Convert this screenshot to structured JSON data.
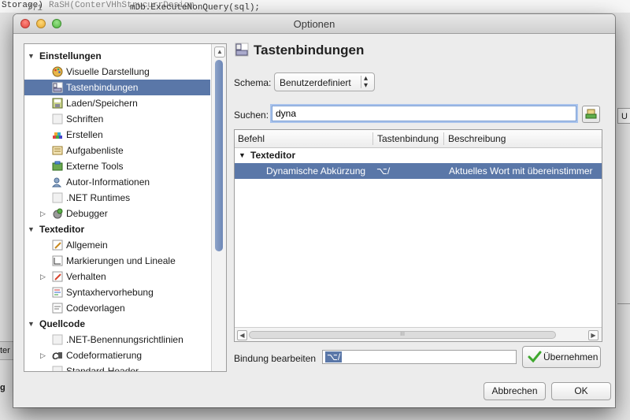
{
  "background": {
    "code_line_1": "Storage)",
    "code_line_2": "RaSH(ConterVHhStrucurrDesign",
    "line_number": "771",
    "code_line_3": "mDb.ExecuteNonQuery(sql);",
    "left_strip_text": "ter",
    "left_bold_text": "g",
    "right_button_text": "U"
  },
  "window": {
    "title": "Optionen"
  },
  "tree": {
    "groups": [
      {
        "label": "Einstellungen",
        "items": [
          {
            "label": "Visuelle Darstellung",
            "icon": "palette-icon"
          },
          {
            "label": "Tastenbindungen",
            "icon": "keybinding-icon",
            "selected": true
          },
          {
            "label": "Laden/Speichern",
            "icon": "save-icon"
          },
          {
            "label": "Schriften",
            "icon": "fonts-icon"
          },
          {
            "label": "Erstellen",
            "icon": "build-icon"
          },
          {
            "label": "Aufgabenliste",
            "icon": "tasklist-icon"
          },
          {
            "label": "Externe Tools",
            "icon": "tools-icon"
          },
          {
            "label": "Autor-Informationen",
            "icon": "author-icon"
          },
          {
            "label": ".NET Runtimes",
            "icon": "runtime-icon"
          },
          {
            "label": "Debugger",
            "icon": "debugger-icon",
            "collapsible": true
          }
        ]
      },
      {
        "label": "Texteditor",
        "items": [
          {
            "label": "Allgemein",
            "icon": "edit-icon"
          },
          {
            "label": "Markierungen und Lineale",
            "icon": "ruler-icon"
          },
          {
            "label": "Verhalten",
            "icon": "behavior-icon",
            "collapsible": true
          },
          {
            "label": "Syntaxhervorhebung",
            "icon": "syntax-icon"
          },
          {
            "label": "Codevorlagen",
            "icon": "template-icon"
          }
        ]
      },
      {
        "label": "Quellcode",
        "items": [
          {
            "label": ".NET-Benennungsrichtlinien",
            "icon": "naming-icon"
          },
          {
            "label": "Codeformatierung",
            "icon": "format-icon",
            "collapsible": true
          },
          {
            "label": "Standard-Header",
            "icon": "header-icon"
          }
        ]
      }
    ]
  },
  "panel": {
    "title": "Tastenbindungen",
    "schema_label": "Schema:",
    "schema_value": "Benutzerdefiniert",
    "search_label": "Suchen:",
    "search_value": "dyna",
    "table": {
      "columns": [
        "Befehl",
        "Tastenbindung",
        "Beschreibung"
      ],
      "group": "Texteditor",
      "rows": [
        {
          "command": "Dynamische Abkürzung",
          "binding": "⌥/",
          "description": "Aktuelles Wort mit übereinstimmer"
        }
      ],
      "hscroll_grip": "III"
    },
    "edit_binding_label": "Bindung bearbeiten",
    "edit_binding_value": "⌥/",
    "apply_label": "Übernehmen"
  },
  "buttons": {
    "cancel": "Abbrechen",
    "ok": "OK"
  }
}
